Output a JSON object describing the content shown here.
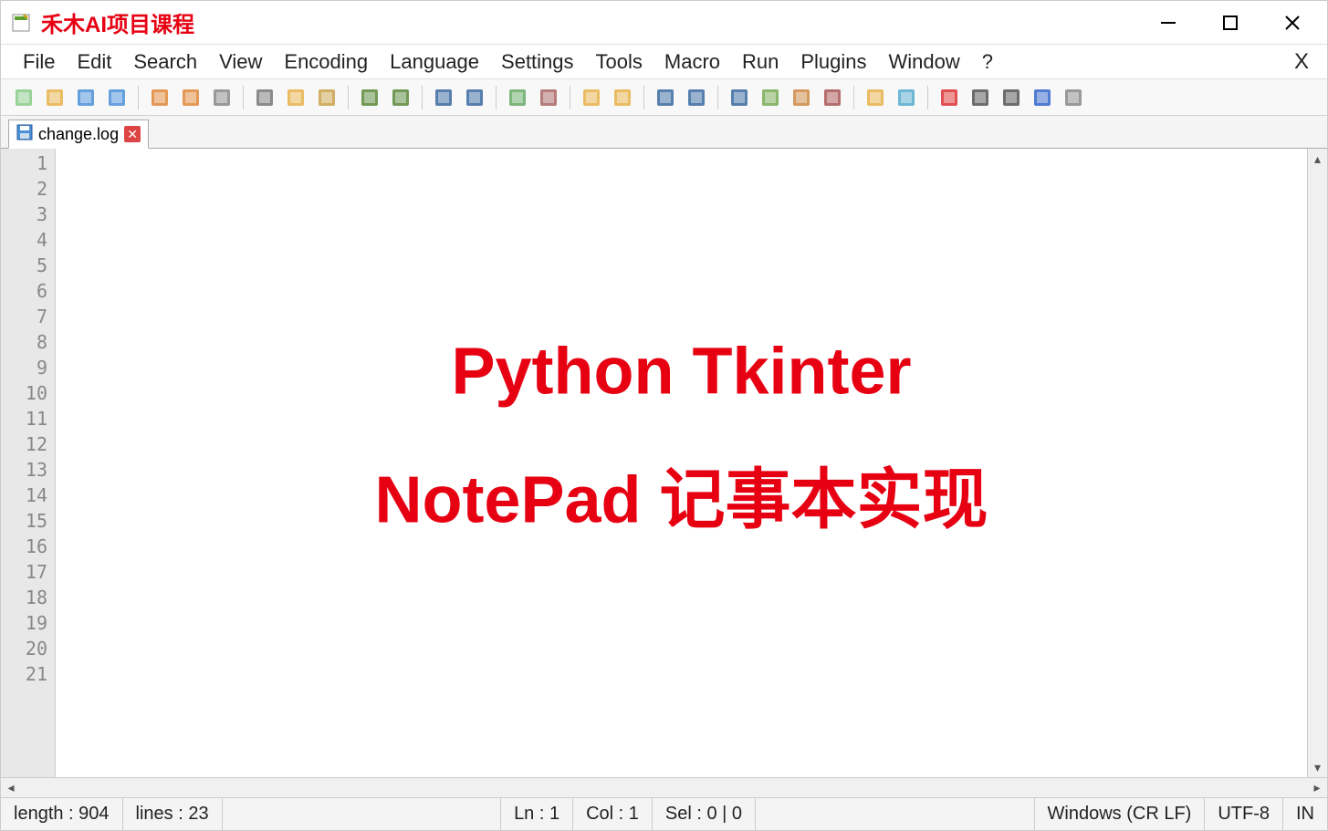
{
  "title": "禾木AI项目课程",
  "menus": [
    "File",
    "Edit",
    "Search",
    "View",
    "Encoding",
    "Language",
    "Settings",
    "Tools",
    "Macro",
    "Run",
    "Plugins",
    "Window",
    "?"
  ],
  "menubar_close": "X",
  "toolbar_icons": [
    "new-file-icon",
    "open-file-icon",
    "save-icon",
    "save-all-icon",
    "sep",
    "close-file-icon",
    "close-all-icon",
    "print-icon",
    "sep",
    "cut-icon",
    "copy-icon",
    "paste-icon",
    "sep",
    "undo-icon",
    "redo-icon",
    "sep",
    "find-icon",
    "replace-icon",
    "sep",
    "zoom-in-icon",
    "zoom-out-icon",
    "sep",
    "sync-v-icon",
    "sync-h-icon",
    "sep",
    "word-wrap-icon",
    "show-all-chars-icon",
    "sep",
    "indent-guide-icon",
    "fold-all-icon",
    "doc-map-icon",
    "function-list-icon",
    "sep",
    "folder-workspace-icon",
    "monitor-icon",
    "sep",
    "record-macro-icon",
    "stop-macro-icon",
    "play-macro-icon",
    "fast-forward-icon",
    "save-macro-icon"
  ],
  "tab": {
    "label": "change.log"
  },
  "line_count_visible": 21,
  "overlay": {
    "line1": "Python Tkinter",
    "line2": "NotePad 记事本实现"
  },
  "status": {
    "length": "length : 904",
    "lines": "lines : 23",
    "ln": "Ln : 1",
    "col": "Col : 1",
    "sel": "Sel : 0 | 0",
    "eol": "Windows (CR LF)",
    "encoding": "UTF-8",
    "mode": "IN"
  }
}
